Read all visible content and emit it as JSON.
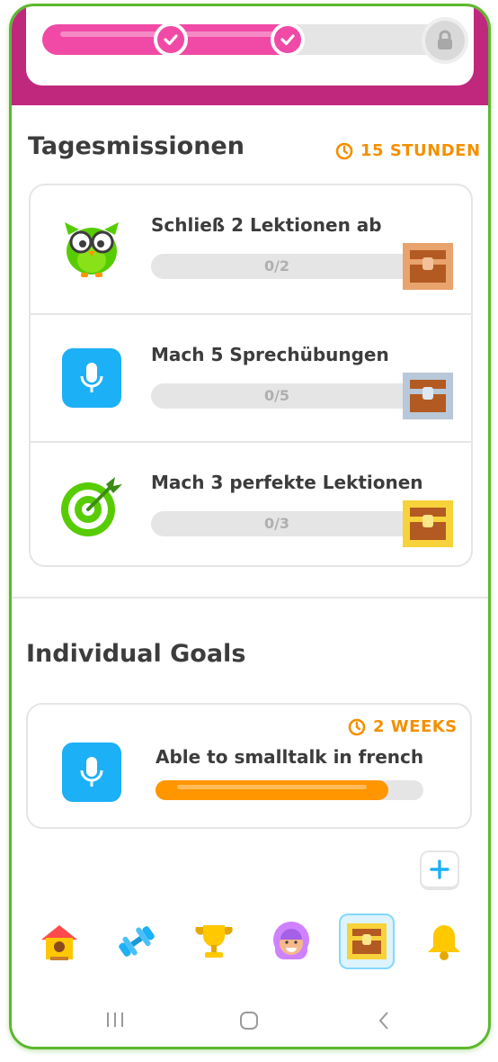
{
  "top_progress": {
    "fill_fraction": 0.62,
    "checkpoints_done": 2,
    "final_locked": true
  },
  "daily_quests": {
    "title": "Tagesmissionen",
    "timer": "15 STUNDEN",
    "items": [
      {
        "icon": "owl-glasses-icon",
        "title": "Schließ 2 Lektionen ab",
        "progress": "0/2",
        "chest": "bronze-chest-icon"
      },
      {
        "icon": "microphone-icon",
        "title": "Mach 5 Sprechübungen",
        "progress": "0/5",
        "chest": "silver-chest-icon"
      },
      {
        "icon": "target-icon",
        "title": "Mach 3 perfekte Lektionen",
        "progress": "0/3",
        "chest": "gold-chest-icon"
      }
    ]
  },
  "individual_goals": {
    "title": "Individual Goals",
    "items": [
      {
        "icon": "microphone-icon",
        "timer": "2 WEEKS",
        "title": "Able to smalltalk in french",
        "progress_fraction": 0.87
      }
    ],
    "add_button_icon": "plus-icon"
  },
  "bottom_nav": [
    {
      "icon": "home-icon",
      "active": false
    },
    {
      "icon": "dumbbell-icon",
      "active": false
    },
    {
      "icon": "trophy-icon",
      "active": false
    },
    {
      "icon": "profile-icon",
      "active": false
    },
    {
      "icon": "quests-chest-icon",
      "active": true
    },
    {
      "icon": "bell-icon",
      "active": false
    }
  ],
  "system_bar": [
    "recent-apps-icon",
    "home-circle-icon",
    "back-icon"
  ],
  "colors": {
    "brand_magenta": "#c0287e",
    "progress_pink": "#f04aa6",
    "accent_orange": "#f49000",
    "accent_blue": "#1cb0f6",
    "border_grey": "#e5e5e5",
    "frame_green": "#5cb82e"
  }
}
